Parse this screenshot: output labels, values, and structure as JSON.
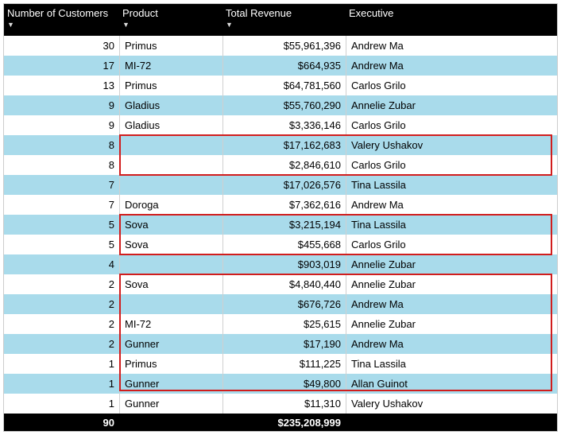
{
  "columns": {
    "num": "Number of Customers",
    "prod": "Product",
    "rev": "Total Revenue",
    "exec": "Executive"
  },
  "sort_glyph": "▼",
  "rows": [
    {
      "num": "30",
      "prod": "Primus",
      "rev": "$55,961,396",
      "exec": "Andrew Ma"
    },
    {
      "num": "17",
      "prod": "MI-72",
      "rev": "$664,935",
      "exec": "Andrew Ma"
    },
    {
      "num": "13",
      "prod": "Primus",
      "rev": "$64,781,560",
      "exec": "Carlos Grilo"
    },
    {
      "num": "9",
      "prod": "Gladius",
      "rev": "$55,760,290",
      "exec": "Annelie Zubar"
    },
    {
      "num": "9",
      "prod": "Gladius",
      "rev": "$3,336,146",
      "exec": "Carlos Grilo"
    },
    {
      "num": "8",
      "prod": "",
      "rev": "$17,162,683",
      "exec": "Valery Ushakov"
    },
    {
      "num": "8",
      "prod": "",
      "rev": "$2,846,610",
      "exec": "Carlos Grilo"
    },
    {
      "num": "7",
      "prod": "",
      "rev": "$17,026,576",
      "exec": "Tina Lassila"
    },
    {
      "num": "7",
      "prod": "Doroga",
      "rev": "$7,362,616",
      "exec": "Andrew Ma"
    },
    {
      "num": "5",
      "prod": "Sova",
      "rev": "$3,215,194",
      "exec": "Tina Lassila"
    },
    {
      "num": "5",
      "prod": "Sova",
      "rev": "$455,668",
      "exec": "Carlos Grilo"
    },
    {
      "num": "4",
      "prod": "",
      "rev": "$903,019",
      "exec": "Annelie Zubar"
    },
    {
      "num": "2",
      "prod": "Sova",
      "rev": "$4,840,440",
      "exec": "Annelie Zubar"
    },
    {
      "num": "2",
      "prod": "",
      "rev": "$676,726",
      "exec": "Andrew Ma"
    },
    {
      "num": "2",
      "prod": "MI-72",
      "rev": "$25,615",
      "exec": "Annelie Zubar"
    },
    {
      "num": "2",
      "prod": "Gunner",
      "rev": "$17,190",
      "exec": "Andrew Ma"
    },
    {
      "num": "1",
      "prod": "Primus",
      "rev": "$111,225",
      "exec": "Tina Lassila"
    },
    {
      "num": "1",
      "prod": "Gunner",
      "rev": "$49,800",
      "exec": "Allan Guinot"
    },
    {
      "num": "1",
      "prod": "Gunner",
      "rev": "$11,310",
      "exec": "Valery Ushakov"
    }
  ],
  "totals": {
    "num": "90",
    "rev": "$235,208,999"
  },
  "chart_data": {
    "type": "table",
    "columns": [
      "Number of Customers",
      "Product",
      "Total Revenue",
      "Executive"
    ],
    "rows": [
      [
        30,
        "Primus",
        55961396,
        "Andrew Ma"
      ],
      [
        17,
        "MI-72",
        664935,
        "Andrew Ma"
      ],
      [
        13,
        "Primus",
        64781560,
        "Carlos Grilo"
      ],
      [
        9,
        "Gladius",
        55760290,
        "Annelie Zubar"
      ],
      [
        9,
        "Gladius",
        3336146,
        "Carlos Grilo"
      ],
      [
        8,
        null,
        17162683,
        "Valery Ushakov"
      ],
      [
        8,
        null,
        2846610,
        "Carlos Grilo"
      ],
      [
        7,
        null,
        17026576,
        "Tina Lassila"
      ],
      [
        7,
        "Doroga",
        7362616,
        "Andrew Ma"
      ],
      [
        5,
        "Sova",
        3215194,
        "Tina Lassila"
      ],
      [
        5,
        "Sova",
        455668,
        "Carlos Grilo"
      ],
      [
        4,
        null,
        903019,
        "Annelie Zubar"
      ],
      [
        2,
        "Sova",
        4840440,
        "Annelie Zubar"
      ],
      [
        2,
        null,
        676726,
        "Andrew Ma"
      ],
      [
        2,
        "MI-72",
        25615,
        "Annelie Zubar"
      ],
      [
        2,
        "Gunner",
        17190,
        "Andrew Ma"
      ],
      [
        1,
        "Primus",
        111225,
        "Tina Lassila"
      ],
      [
        1,
        "Gunner",
        49800,
        "Allan Guinot"
      ],
      [
        1,
        "Gunner",
        11310,
        "Valery Ushakov"
      ]
    ],
    "totals": {
      "Number of Customers": 90,
      "Total Revenue": 235208999
    },
    "highlighted_row_groups": [
      [
        5,
        6
      ],
      [
        9,
        10
      ],
      [
        12,
        13,
        14,
        15,
        16,
        17,
        18
      ]
    ]
  }
}
